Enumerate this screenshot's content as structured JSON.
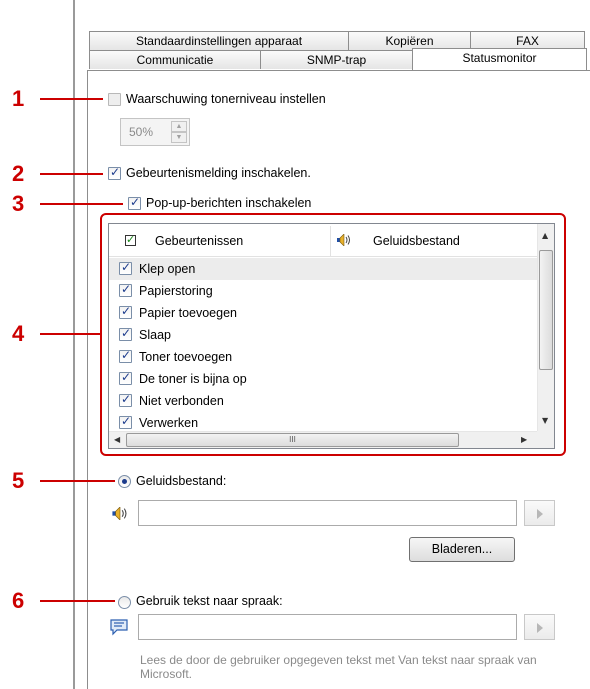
{
  "tabs": {
    "row1": [
      "Standaardinstellingen apparaat",
      "Kopiëren",
      "FAX"
    ],
    "row2": [
      "Communicatie",
      "SNMP-trap",
      "Statusmonitor"
    ],
    "active": "Statusmonitor"
  },
  "callouts": [
    "1",
    "2",
    "3",
    "4",
    "5",
    "6"
  ],
  "toner_warning": {
    "label": "Waarschuwing tonerniveau instellen",
    "checked": false,
    "level_value": "50%"
  },
  "event_notification": {
    "label": "Gebeurtenismelding inschakelen.",
    "checked": true
  },
  "popup_messages": {
    "label": "Pop-up-berichten inschakelen",
    "checked": true
  },
  "events_list": {
    "header_events": "Gebeurtenissen",
    "header_sound": "Geluidsbestand",
    "rows": [
      "Klep open",
      "Papierstoring",
      "Papier toevoegen",
      "Slaap",
      "Toner toevoegen",
      "De toner is bijna op",
      "Niet verbonden",
      "Verwerken"
    ],
    "scroll_grip": "III"
  },
  "sound_file": {
    "label": "Geluidsbestand:",
    "selected": true,
    "value": "",
    "browse_label": "Bladeren..."
  },
  "tts": {
    "label": "Gebruik tekst naar spraak:",
    "selected": false,
    "value": "",
    "hint": "Lees de door de gebruiker opgegeven tekst met Van tekst naar spraak van Microsoft."
  },
  "colors": {
    "callout": "#cc0000",
    "check": "#1c3b8c"
  }
}
